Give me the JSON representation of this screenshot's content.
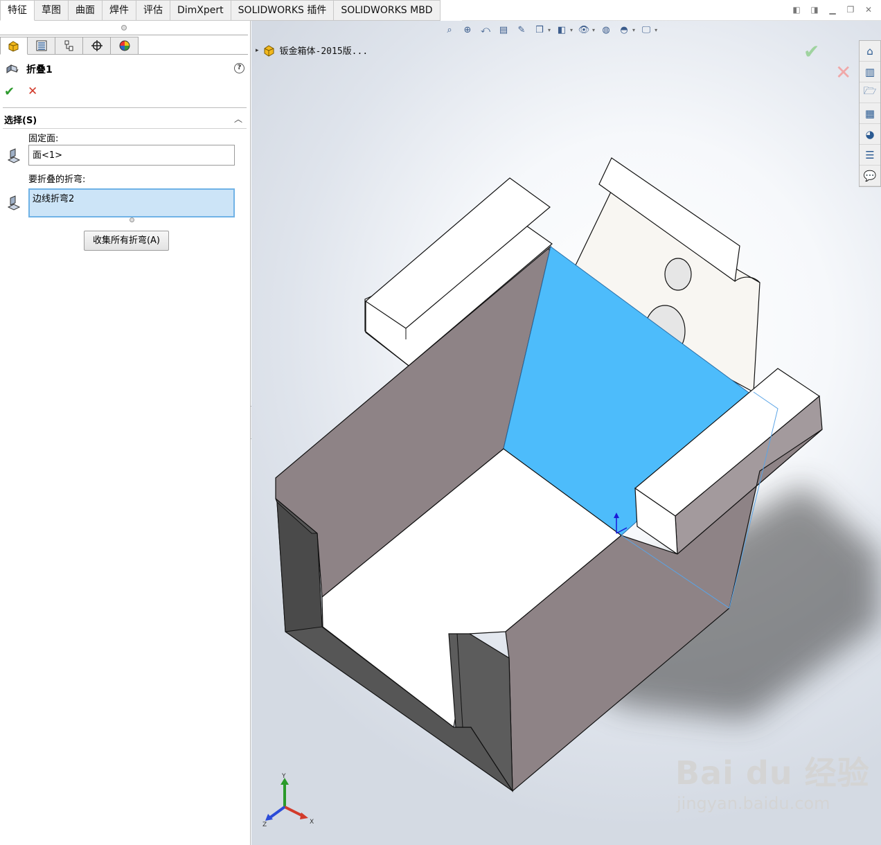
{
  "tabs": [
    "特征",
    "草图",
    "曲面",
    "焊件",
    "评估",
    "DimXpert",
    "SOLIDWORKS 插件",
    "SOLIDWORKS MBD"
  ],
  "property_manager": {
    "title": "折叠1",
    "group_title": "选择(S)",
    "fixed_face_label": "固定面:",
    "fixed_face_value": "面<1>",
    "bends_label": "要折叠的折弯:",
    "bends_value": "边线折弯2",
    "collect_button": "收集所有折弯(A)"
  },
  "feature_tree": {
    "part_name": "钣金箱体-2015版..."
  },
  "triad_labels": {
    "x": "X",
    "y": "Y",
    "z": "Z"
  },
  "watermark": {
    "main": "Bai du 经验",
    "sub": "jingyan.baidu.com"
  },
  "colors": {
    "selected_face": "#4dbcfb",
    "sheet_gray": "#8e8386",
    "sheet_dark": "#565656",
    "sheet_white": "#ffffff",
    "accept": "#2e9b2e",
    "cancel": "#d23a2a"
  },
  "icons": {
    "ok": "✔",
    "cancel": "✕",
    "help": "?",
    "collapse": "︿",
    "tree_expand": "▸"
  }
}
